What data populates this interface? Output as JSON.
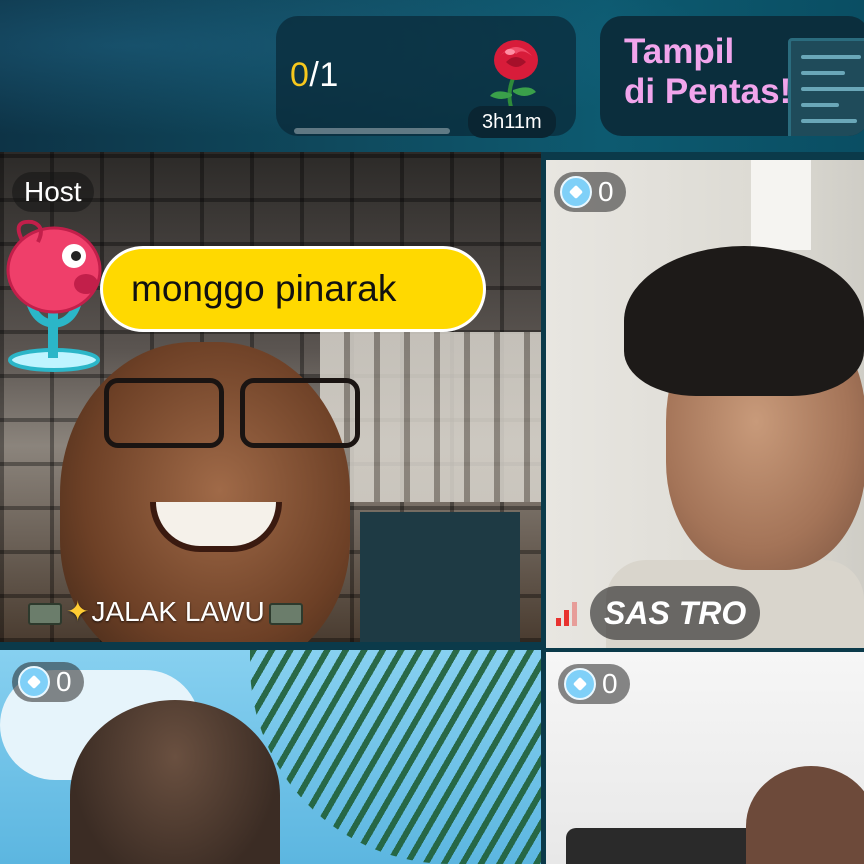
{
  "quest": {
    "progress_done": "0",
    "progress_total": "/1",
    "progress_fraction": 0,
    "timer": "3h11m",
    "gift_icon": "rose-icon"
  },
  "promo": {
    "text": "Tampil\ndi Pentas!"
  },
  "host_tile": {
    "badge": "Host",
    "bubble_text": "monggo pinarak",
    "name": "JALAK LAWU"
  },
  "seats": [
    {
      "coins": "0",
      "name": "SAS TRO"
    },
    {
      "coins": "0"
    },
    {
      "coins": "0"
    }
  ],
  "colors": {
    "accent_yellow": "#ffd900",
    "promo_pink": "#f1a5ec",
    "signal_red": "#e8322f"
  }
}
